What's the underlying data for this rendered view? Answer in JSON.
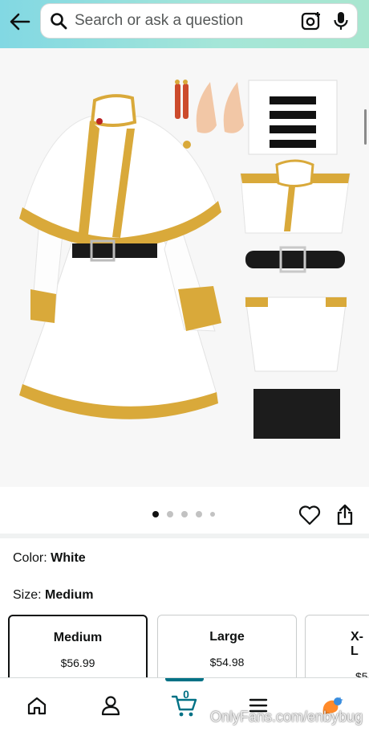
{
  "header": {
    "search_placeholder": "Search or ask a question",
    "back_icon": "arrow-left-icon",
    "search_icon": "magnifier-icon",
    "camera_icon": "camera-scan-icon",
    "mic_icon": "microphone-icon"
  },
  "gallery": {
    "dots": [
      "active",
      "inactive",
      "inactive",
      "inactive",
      "small"
    ],
    "heart_icon": "heart-outline-icon",
    "share_icon": "share-icon"
  },
  "options": {
    "color_label": "Color:",
    "color_value": "White",
    "size_label": "Size:",
    "size_value": "Medium",
    "sizes": [
      {
        "name": "Medium",
        "price": "$56.99",
        "selected": true
      },
      {
        "name": "Large",
        "price": "$54.98",
        "selected": false
      },
      {
        "name": "X-L",
        "price": "$5",
        "selected": false
      }
    ]
  },
  "bottom_nav": {
    "items": [
      "home-icon",
      "account-icon",
      "cart-icon",
      "menu-icon",
      "rufus-icon"
    ],
    "cart_count": "0",
    "accent": "#007185"
  },
  "watermark": "OnlyFans.com/enbybug",
  "colors": {
    "header_start": "#82d8e3",
    "header_end": "#a8e6cf",
    "gold_trim": "#d9a93a"
  }
}
